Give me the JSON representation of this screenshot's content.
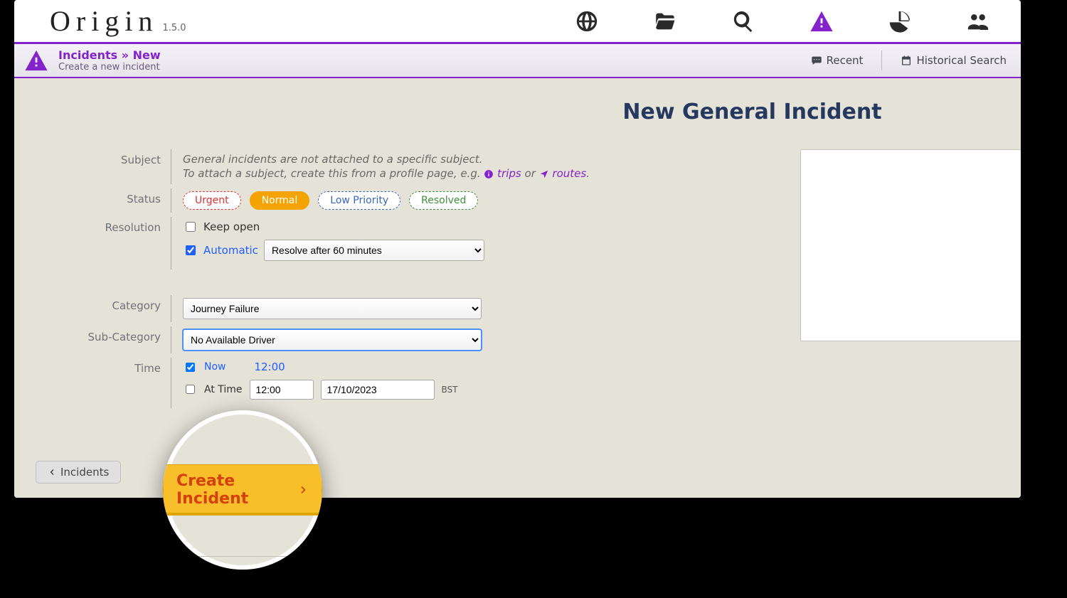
{
  "brand": {
    "name": "Origin",
    "version": "1.5.0"
  },
  "nav_icons": [
    "globe",
    "folder",
    "search",
    "warning",
    "chart",
    "users"
  ],
  "crumb": {
    "main": "Incidents » New",
    "sub": "Create a new incident",
    "links": {
      "recent": "Recent",
      "historical": "Historical Search"
    }
  },
  "main": {
    "title": "New General Incident",
    "labels": {
      "subject": "Subject",
      "status": "Status",
      "resolution": "Resolution",
      "category": "Category",
      "subcategory": "Sub-Category",
      "time": "Time"
    },
    "subject": {
      "line1": "General incidents are not attached to a specific subject.",
      "line2_pre": "To attach a subject, create this from a profile page, e.g. ",
      "trips": "trips",
      "or": " or ",
      "routes": "routes",
      "dot": "."
    },
    "status_badges": {
      "urgent": "Urgent",
      "normal": "Normal",
      "low": "Low Priority",
      "resolved": "Resolved"
    },
    "resolution": {
      "keep_open": "Keep open",
      "automatic": "Automatic",
      "select_value": "Resolve after 60 minutes"
    },
    "category": "Journey Failure",
    "subcategory": "No Available Driver",
    "time": {
      "now": "Now",
      "now_val": "12:00",
      "at_time": "At Time",
      "time_input": "12:00",
      "date_input": "17/10/2023",
      "tz": "BST"
    },
    "back_btn": "Incidents",
    "create_btn": "Create Incident"
  }
}
